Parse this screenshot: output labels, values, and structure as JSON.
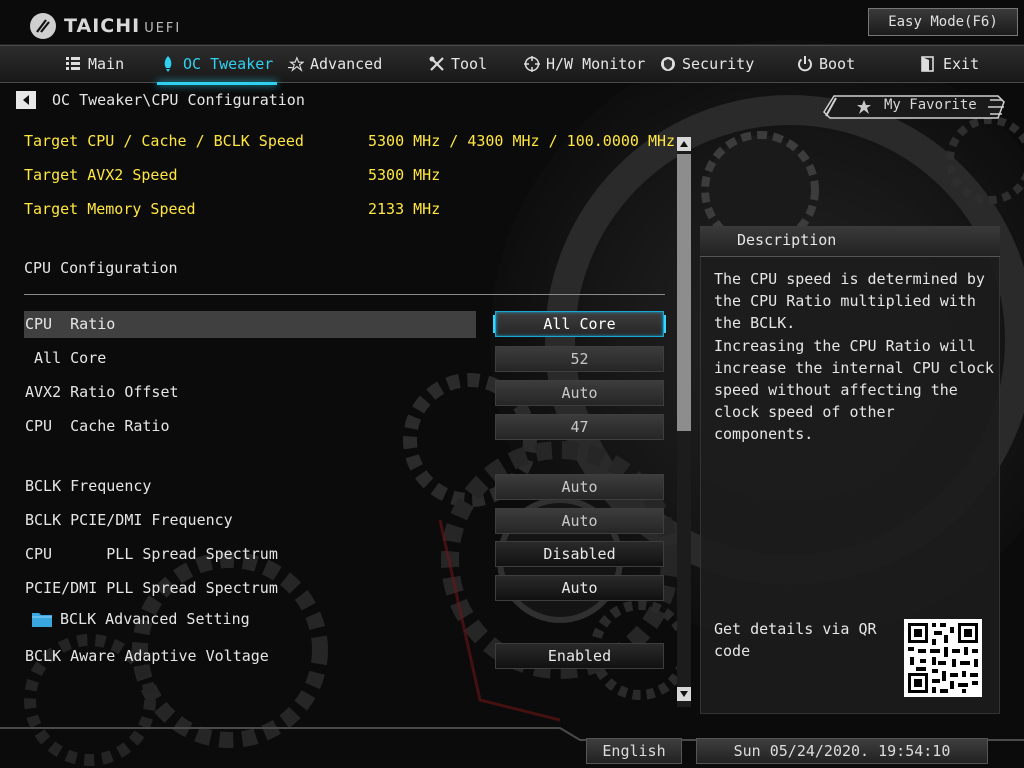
{
  "header": {
    "brand": "TAICHI",
    "brand_suffix": "UEFI",
    "easy_mode_label": "Easy Mode(F6)"
  },
  "nav": {
    "tabs": [
      {
        "label": "Main",
        "icon": "list-icon"
      },
      {
        "label": "OC Tweaker",
        "icon": "rocket-icon",
        "active": true
      },
      {
        "label": "Advanced",
        "icon": "star-icon"
      },
      {
        "label": "Tool",
        "icon": "tools-icon"
      },
      {
        "label": "H/W Monitor",
        "icon": "crosshair-icon"
      },
      {
        "label": "Security",
        "icon": "shield-icon"
      },
      {
        "label": "Boot",
        "icon": "power-icon"
      },
      {
        "label": "Exit",
        "icon": "exit-icon"
      }
    ]
  },
  "breadcrumb": "OC Tweaker\\CPU Configuration",
  "favorite_label": "My Favorite",
  "targets": [
    {
      "label": "Target CPU / Cache / BCLK Speed",
      "value": "5300 MHz / 4300 MHz / 100.0000 MHz"
    },
    {
      "label": "Target AVX2 Speed",
      "value": "5300 MHz"
    },
    {
      "label": "Target Memory Speed",
      "value": "2133 MHz"
    }
  ],
  "section_title": "CPU Configuration",
  "settings": [
    {
      "label": "CPU  Ratio",
      "value": "All Core"
    },
    {
      "label": " All Core",
      "value": "52"
    },
    {
      "label": "AVX2 Ratio Offset",
      "value": "Auto"
    },
    {
      "label": "CPU  Cache Ratio",
      "value": "47"
    },
    {
      "label": "BCLK Frequency",
      "value": "Auto"
    },
    {
      "label": "BCLK PCIE/DMI Frequency",
      "value": "Auto"
    },
    {
      "label": "CPU      PLL Spread Spectrum",
      "value": "Disabled"
    },
    {
      "label": "PCIE/DMI PLL Spread Spectrum",
      "value": "Auto"
    },
    {
      "label": "BCLK Advanced Setting",
      "value": ""
    },
    {
      "label": "BCLK Aware Adaptive Voltage",
      "value": "Enabled"
    }
  ],
  "description": {
    "title": "Description",
    "text": "The CPU speed is determined by the CPU Ratio multiplied with the BCLK.\nIncreasing the CPU Ratio will increase the internal CPU clock speed without affecting the clock speed of other components.",
    "qr_label": "Get details via QR code"
  },
  "footer": {
    "language": "English",
    "datetime": "Sun 05/24/2020. 19:54:10"
  },
  "colors": {
    "accent": "#30d0f0",
    "target_text": "#ffe640"
  }
}
